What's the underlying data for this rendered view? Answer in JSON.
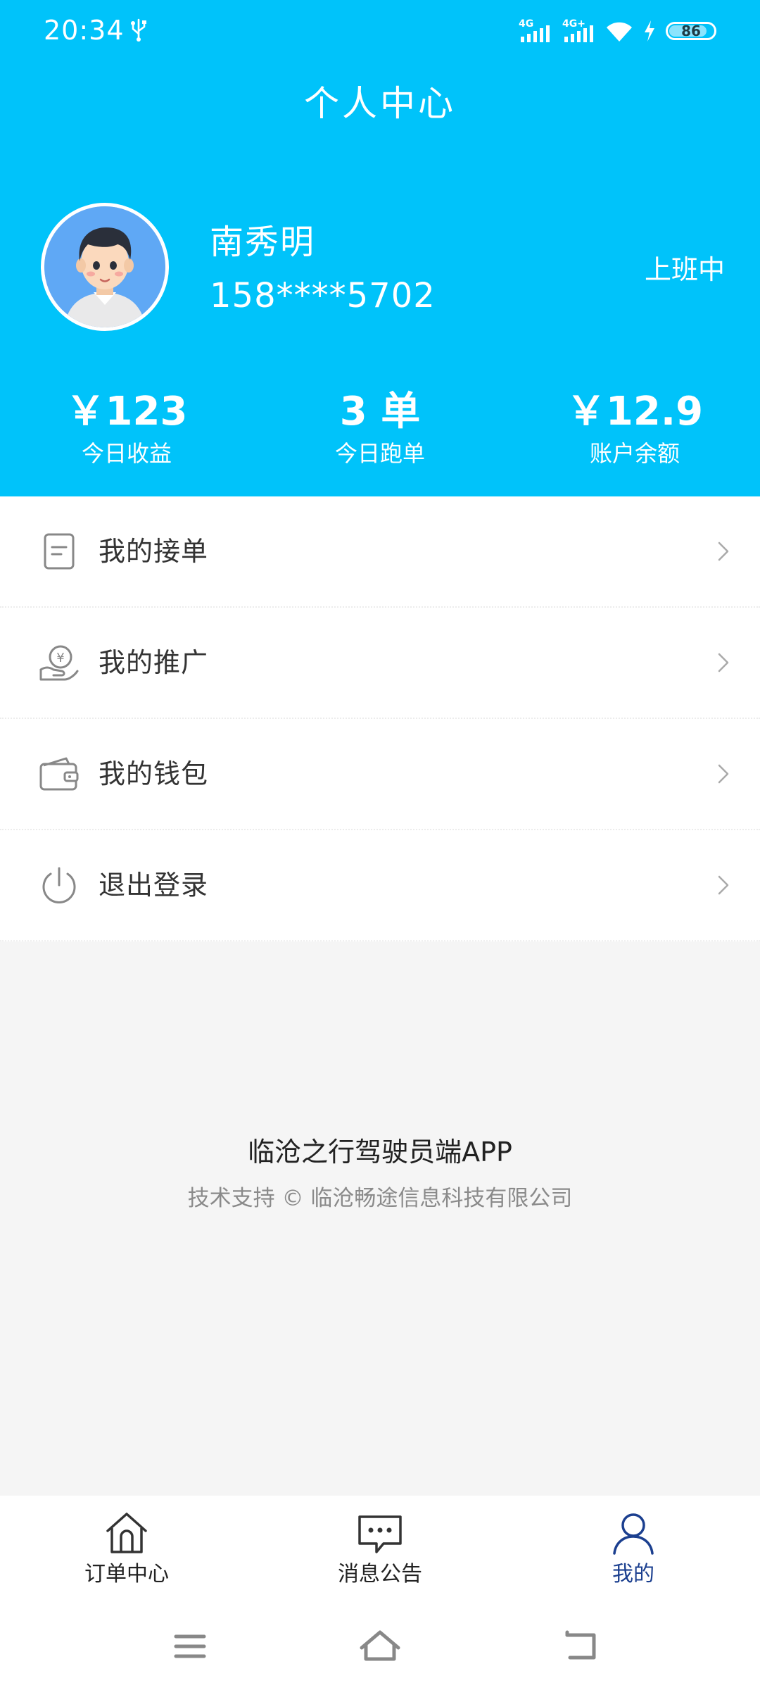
{
  "status_bar": {
    "time": "20:34",
    "network1": "4G",
    "network2": "4G+",
    "battery_level": "86",
    "battery_percent": 86
  },
  "header": {
    "title": "个人中心"
  },
  "user": {
    "name": "南秀明",
    "phone": "158****5702",
    "work_status": "上班中"
  },
  "stats": [
    {
      "value": "￥123",
      "label": "今日收益"
    },
    {
      "value": "3 单",
      "label": "今日跑单"
    },
    {
      "value": "￥12.9",
      "label": "账户余额"
    }
  ],
  "menu": {
    "items": [
      {
        "label": "我的接单",
        "icon": "document-icon"
      },
      {
        "label": "我的推广",
        "icon": "yuan-hand-icon"
      },
      {
        "label": "我的钱包",
        "icon": "wallet-icon"
      },
      {
        "label": "退出登录",
        "icon": "power-icon"
      }
    ]
  },
  "footer": {
    "app_name": "临沧之行驾驶员端APP",
    "support": "技术支持 © 临沧畅途信息科技有限公司"
  },
  "tabbar": {
    "items": [
      {
        "label": "订单中心",
        "icon": "home-icon",
        "active": false
      },
      {
        "label": "消息公告",
        "icon": "message-icon",
        "active": false
      },
      {
        "label": "我的",
        "icon": "person-icon",
        "active": true
      }
    ]
  },
  "colors": {
    "primary": "#00c3fa",
    "active_tab": "#1b3f8f",
    "background": "#f5f5f5"
  }
}
